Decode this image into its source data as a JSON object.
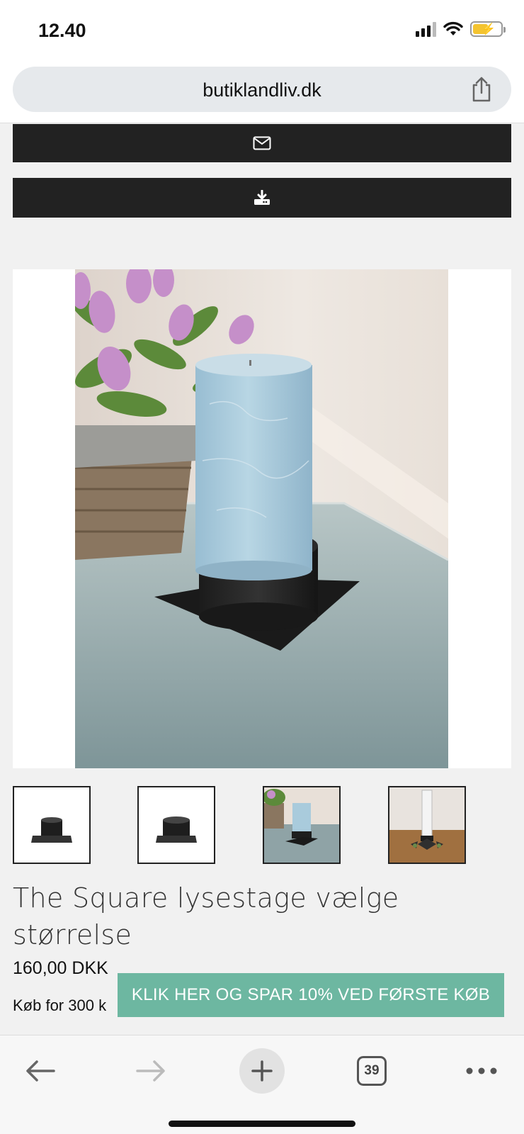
{
  "status_bar": {
    "time": "12.40"
  },
  "browser": {
    "url": "butiklandliv.dk",
    "tab_count": "39"
  },
  "actions": {
    "email_icon": "envelope-icon",
    "download_icon": "download-icon"
  },
  "product": {
    "title": "The Square lysestage vælge størrelse",
    "price": "160,00 DKK",
    "shipping_text": "Køb for 300 k"
  },
  "promo": {
    "label": "KLIK HER OG SPAR 10% VED FØRSTE KØB"
  },
  "colors": {
    "button_dark": "#222222",
    "promo_green": "#6db7a1",
    "candle_blue": "#a9cbdc"
  }
}
